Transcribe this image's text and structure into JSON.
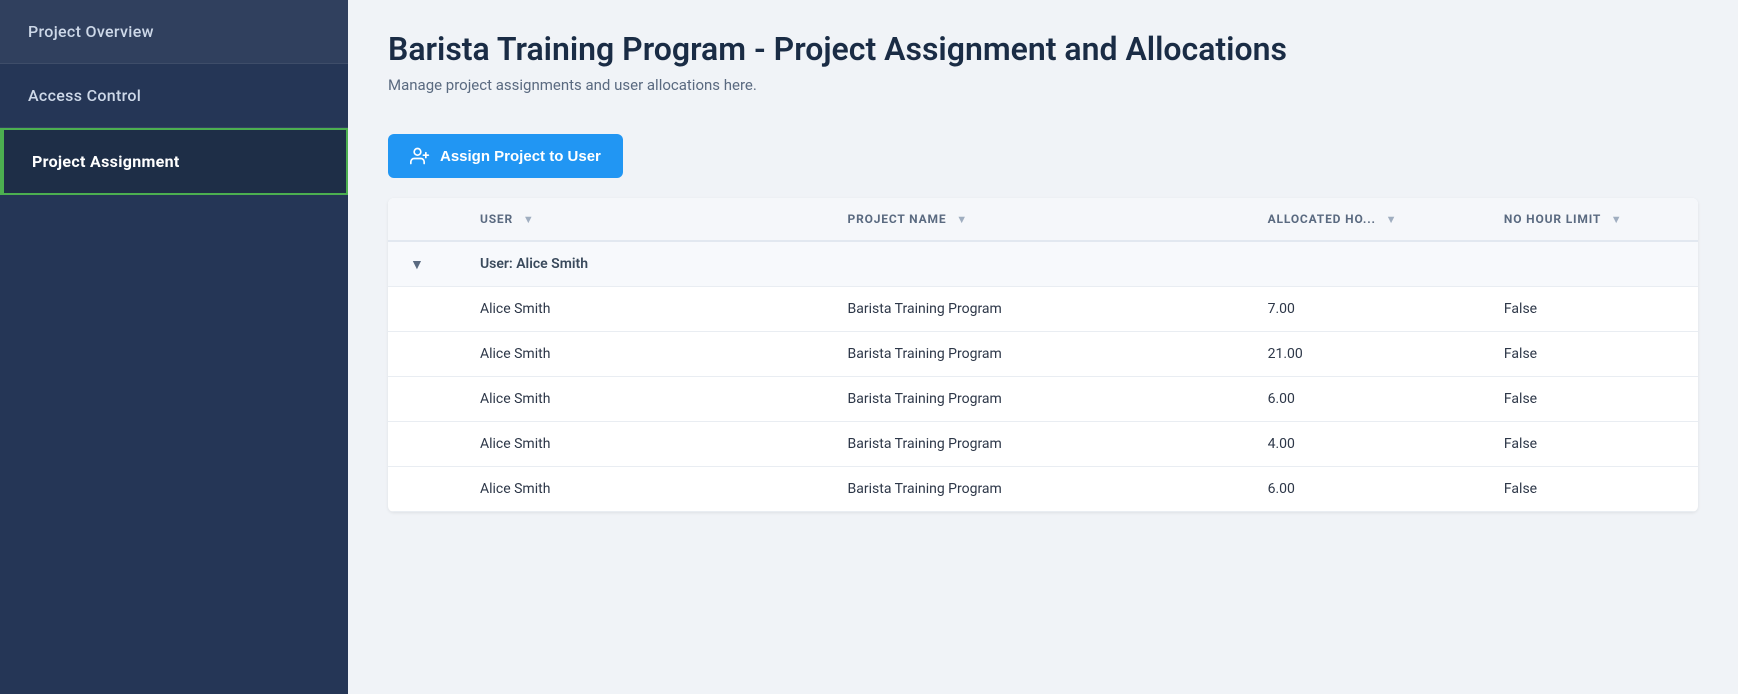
{
  "sidebar": {
    "items": [
      {
        "id": "project-overview",
        "label": "Project Overview",
        "active": false
      },
      {
        "id": "access-control",
        "label": "Access Control",
        "active": false
      },
      {
        "id": "project-assignment",
        "label": "Project Assignment",
        "active": true
      }
    ]
  },
  "main": {
    "title": "Barista Training Program - Project Assignment and Allocations",
    "subtitle": "Manage project assignments and user allocations here.",
    "assign_button_label": "Assign Project to User",
    "table": {
      "columns": [
        {
          "id": "expand",
          "label": ""
        },
        {
          "id": "user",
          "label": "USER"
        },
        {
          "id": "project_name",
          "label": "PROJECT NAME"
        },
        {
          "id": "allocated_hours",
          "label": "ALLOCATED HO..."
        },
        {
          "id": "no_hour_limit",
          "label": "NO HOUR LIMIT"
        }
      ],
      "group_row": {
        "label": "User: Alice Smith"
      },
      "rows": [
        {
          "user": "Alice Smith",
          "project_name": "Barista Training Program",
          "allocated_hours": "7.00",
          "no_hour_limit": "False"
        },
        {
          "user": "Alice Smith",
          "project_name": "Barista Training Program",
          "allocated_hours": "21.00",
          "no_hour_limit": "False"
        },
        {
          "user": "Alice Smith",
          "project_name": "Barista Training Program",
          "allocated_hours": "6.00",
          "no_hour_limit": "False"
        },
        {
          "user": "Alice Smith",
          "project_name": "Barista Training Program",
          "allocated_hours": "4.00",
          "no_hour_limit": "False"
        },
        {
          "user": "Alice Smith",
          "project_name": "Barista Training Program",
          "allocated_hours": "6.00",
          "no_hour_limit": "False"
        }
      ]
    }
  }
}
